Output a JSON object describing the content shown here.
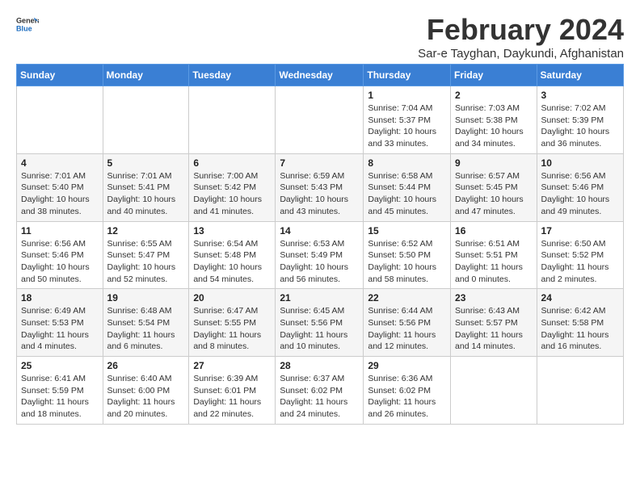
{
  "logo": {
    "line1": "General",
    "line2": "Blue"
  },
  "title": "February 2024",
  "subtitle": "Sar-e Tayghan, Daykundi, Afghanistan",
  "days_of_week": [
    "Sunday",
    "Monday",
    "Tuesday",
    "Wednesday",
    "Thursday",
    "Friday",
    "Saturday"
  ],
  "weeks": [
    [
      {
        "day": "",
        "info": ""
      },
      {
        "day": "",
        "info": ""
      },
      {
        "day": "",
        "info": ""
      },
      {
        "day": "",
        "info": ""
      },
      {
        "day": "1",
        "info": "Sunrise: 7:04 AM\nSunset: 5:37 PM\nDaylight: 10 hours\nand 33 minutes."
      },
      {
        "day": "2",
        "info": "Sunrise: 7:03 AM\nSunset: 5:38 PM\nDaylight: 10 hours\nand 34 minutes."
      },
      {
        "day": "3",
        "info": "Sunrise: 7:02 AM\nSunset: 5:39 PM\nDaylight: 10 hours\nand 36 minutes."
      }
    ],
    [
      {
        "day": "4",
        "info": "Sunrise: 7:01 AM\nSunset: 5:40 PM\nDaylight: 10 hours\nand 38 minutes."
      },
      {
        "day": "5",
        "info": "Sunrise: 7:01 AM\nSunset: 5:41 PM\nDaylight: 10 hours\nand 40 minutes."
      },
      {
        "day": "6",
        "info": "Sunrise: 7:00 AM\nSunset: 5:42 PM\nDaylight: 10 hours\nand 41 minutes."
      },
      {
        "day": "7",
        "info": "Sunrise: 6:59 AM\nSunset: 5:43 PM\nDaylight: 10 hours\nand 43 minutes."
      },
      {
        "day": "8",
        "info": "Sunrise: 6:58 AM\nSunset: 5:44 PM\nDaylight: 10 hours\nand 45 minutes."
      },
      {
        "day": "9",
        "info": "Sunrise: 6:57 AM\nSunset: 5:45 PM\nDaylight: 10 hours\nand 47 minutes."
      },
      {
        "day": "10",
        "info": "Sunrise: 6:56 AM\nSunset: 5:46 PM\nDaylight: 10 hours\nand 49 minutes."
      }
    ],
    [
      {
        "day": "11",
        "info": "Sunrise: 6:56 AM\nSunset: 5:46 PM\nDaylight: 10 hours\nand 50 minutes."
      },
      {
        "day": "12",
        "info": "Sunrise: 6:55 AM\nSunset: 5:47 PM\nDaylight: 10 hours\nand 52 minutes."
      },
      {
        "day": "13",
        "info": "Sunrise: 6:54 AM\nSunset: 5:48 PM\nDaylight: 10 hours\nand 54 minutes."
      },
      {
        "day": "14",
        "info": "Sunrise: 6:53 AM\nSunset: 5:49 PM\nDaylight: 10 hours\nand 56 minutes."
      },
      {
        "day": "15",
        "info": "Sunrise: 6:52 AM\nSunset: 5:50 PM\nDaylight: 10 hours\nand 58 minutes."
      },
      {
        "day": "16",
        "info": "Sunrise: 6:51 AM\nSunset: 5:51 PM\nDaylight: 11 hours\nand 0 minutes."
      },
      {
        "day": "17",
        "info": "Sunrise: 6:50 AM\nSunset: 5:52 PM\nDaylight: 11 hours\nand 2 minutes."
      }
    ],
    [
      {
        "day": "18",
        "info": "Sunrise: 6:49 AM\nSunset: 5:53 PM\nDaylight: 11 hours\nand 4 minutes."
      },
      {
        "day": "19",
        "info": "Sunrise: 6:48 AM\nSunset: 5:54 PM\nDaylight: 11 hours\nand 6 minutes."
      },
      {
        "day": "20",
        "info": "Sunrise: 6:47 AM\nSunset: 5:55 PM\nDaylight: 11 hours\nand 8 minutes."
      },
      {
        "day": "21",
        "info": "Sunrise: 6:45 AM\nSunset: 5:56 PM\nDaylight: 11 hours\nand 10 minutes."
      },
      {
        "day": "22",
        "info": "Sunrise: 6:44 AM\nSunset: 5:56 PM\nDaylight: 11 hours\nand 12 minutes."
      },
      {
        "day": "23",
        "info": "Sunrise: 6:43 AM\nSunset: 5:57 PM\nDaylight: 11 hours\nand 14 minutes."
      },
      {
        "day": "24",
        "info": "Sunrise: 6:42 AM\nSunset: 5:58 PM\nDaylight: 11 hours\nand 16 minutes."
      }
    ],
    [
      {
        "day": "25",
        "info": "Sunrise: 6:41 AM\nSunset: 5:59 PM\nDaylight: 11 hours\nand 18 minutes."
      },
      {
        "day": "26",
        "info": "Sunrise: 6:40 AM\nSunset: 6:00 PM\nDaylight: 11 hours\nand 20 minutes."
      },
      {
        "day": "27",
        "info": "Sunrise: 6:39 AM\nSunset: 6:01 PM\nDaylight: 11 hours\nand 22 minutes."
      },
      {
        "day": "28",
        "info": "Sunrise: 6:37 AM\nSunset: 6:02 PM\nDaylight: 11 hours\nand 24 minutes."
      },
      {
        "day": "29",
        "info": "Sunrise: 6:36 AM\nSunset: 6:02 PM\nDaylight: 11 hours\nand 26 minutes."
      },
      {
        "day": "",
        "info": ""
      },
      {
        "day": "",
        "info": ""
      }
    ]
  ]
}
